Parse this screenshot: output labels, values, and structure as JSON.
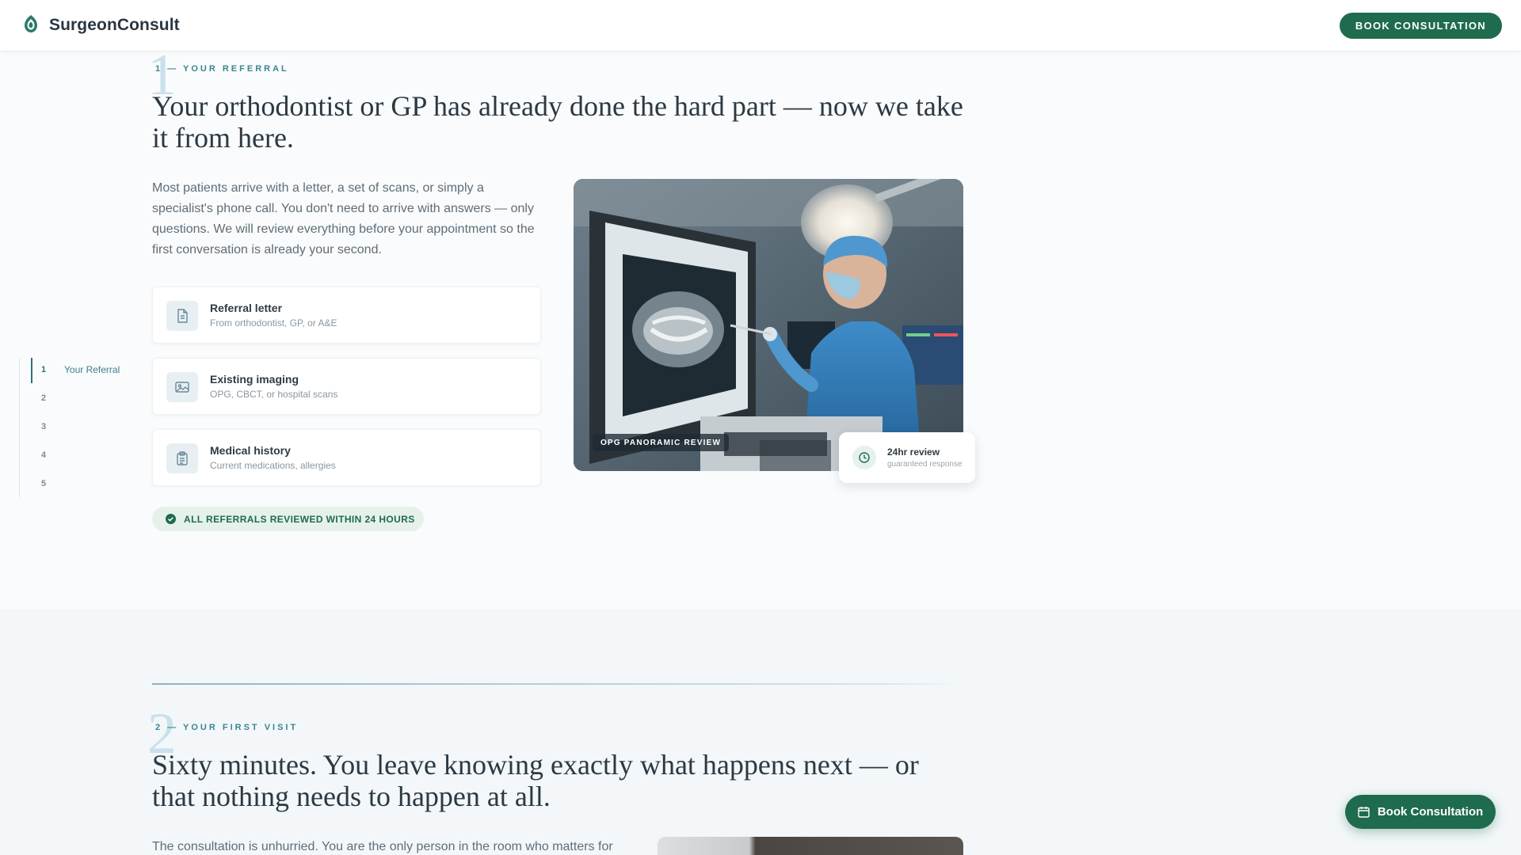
{
  "header": {
    "brand": "SurgeonConsult",
    "cta": "BOOK CONSULTATION"
  },
  "sidenav": {
    "items": [
      {
        "num": "1",
        "label": "Your Referral",
        "active": true
      },
      {
        "num": "2",
        "label": ""
      },
      {
        "num": "3",
        "label": ""
      },
      {
        "num": "4",
        "label": ""
      },
      {
        "num": "5",
        "label": ""
      }
    ]
  },
  "section1": {
    "numeral": "1",
    "eyebrow": "1 — YOUR REFERRAL",
    "heading": "Your orthodontist or GP has already done the hard part — now we take it from here.",
    "paragraph": "Most patients arrive with a letter, a set of scans, or simply a specialist's phone call. You don't need to arrive with answers — only questions. We will review everything before your appointment so the first conversation is already your second.",
    "cards": [
      {
        "icon": "document-icon",
        "title": "Referral letter",
        "subtitle": "From orthodontist, GP, or A&E"
      },
      {
        "icon": "image-icon",
        "title": "Existing imaging",
        "subtitle": "OPG, CBCT, or hospital scans"
      },
      {
        "icon": "clipboard-icon",
        "title": "Medical history",
        "subtitle": "Current medications, allergies"
      }
    ],
    "pill": "ALL REFERRALS REVIEWED WITHIN 24 HOURS",
    "photo_tag": "OPG PANORAMIC REVIEW",
    "review": {
      "title": "24hr review",
      "subtitle": "guaranteed response"
    }
  },
  "section2": {
    "numeral": "2",
    "eyebrow": "2 — YOUR FIRST VISIT",
    "heading": "Sixty minutes. You leave knowing exactly what happens next — or that nothing needs to happen at all.",
    "paragraph": "The consultation is unhurried. You are the only person in the room who matters for"
  },
  "fab": {
    "label": "Book Consultation"
  },
  "colors": {
    "brand_green": "#1f6b4e",
    "accent_teal": "#3d8494",
    "numeral": "#c9e1ea"
  }
}
